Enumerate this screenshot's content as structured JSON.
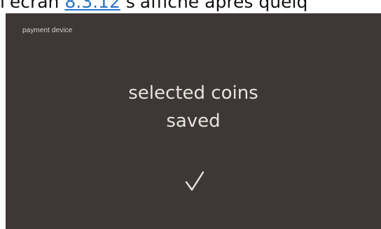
{
  "caption": {
    "prefix": "l'écran ",
    "link": "8.3.12",
    "suffix": " s'affiche après quelq"
  },
  "screen": {
    "header": "payment device",
    "message_line1": "selected coins",
    "message_line2": "saved",
    "confirm_icon": "checkmark-icon"
  },
  "colors": {
    "screen_background": "#3d3835",
    "screen_text": "#e6e3df",
    "link": "#2a74c5"
  }
}
